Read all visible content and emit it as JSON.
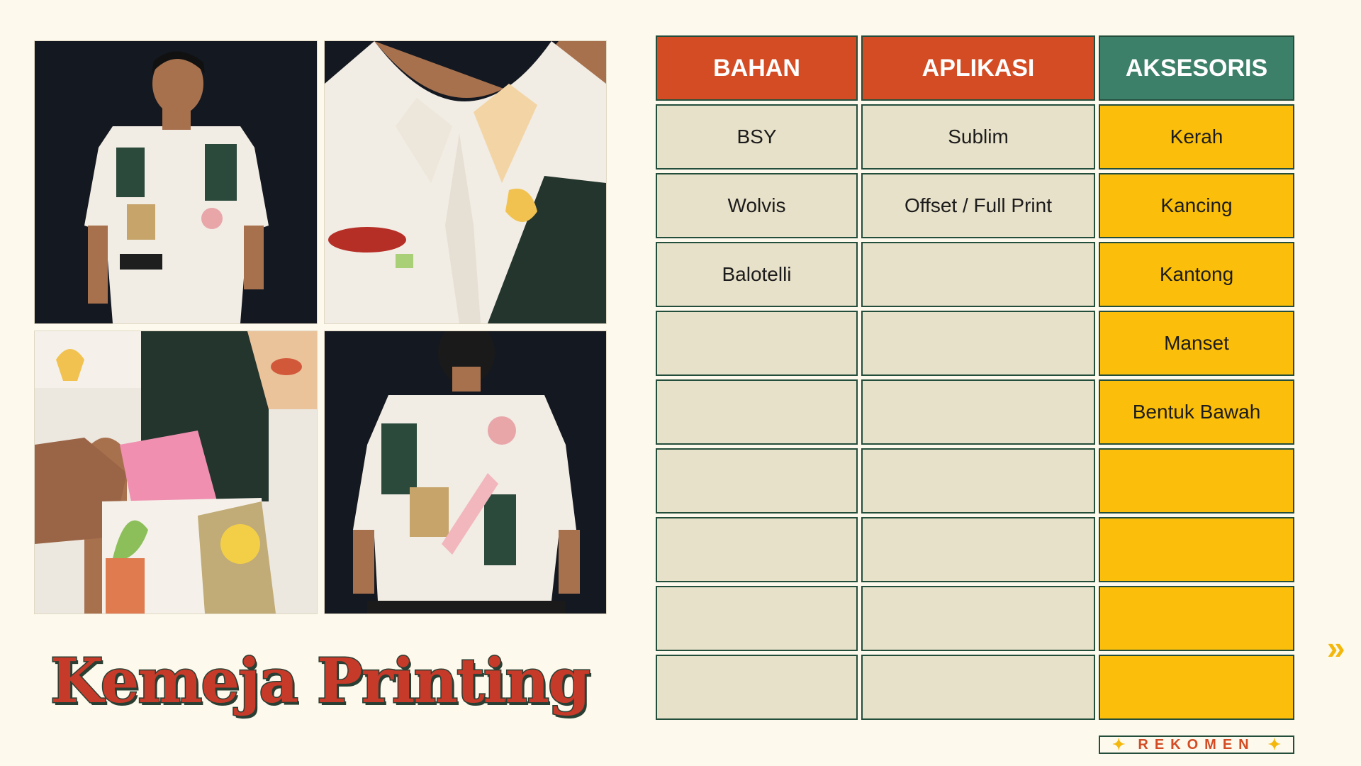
{
  "title": "Kemeja Printing",
  "photos": [
    {
      "icon": "model-front-photo"
    },
    {
      "icon": "collar-closeup-photo"
    },
    {
      "icon": "pocket-closeup-photo"
    },
    {
      "icon": "model-back-photo"
    }
  ],
  "table": {
    "headers": [
      "BAHAN",
      "APLIKASI",
      "AKSESORIS"
    ],
    "header_colors": [
      "#d34c24",
      "#d34c24",
      "#3c8069"
    ],
    "rows": [
      [
        "BSY",
        "Sublim",
        "Kerah"
      ],
      [
        "Wolvis",
        "Offset / Full Print",
        "Kancing"
      ],
      [
        "Balotelli",
        "",
        "Kantong"
      ],
      [
        "",
        "",
        "Manset"
      ],
      [
        "",
        "",
        "Bentuk Bawah"
      ],
      [
        "",
        "",
        ""
      ],
      [
        "",
        "",
        ""
      ],
      [
        "",
        "",
        ""
      ],
      [
        "",
        "",
        ""
      ]
    ]
  },
  "next_icon": "double-chevron-right-icon",
  "badge": {
    "label": "REKOMEN",
    "icon": "sparkle-icon"
  },
  "colors": {
    "background": "#fdf9ec",
    "title": "#c63a2a",
    "header_red": "#d34c24",
    "header_teal": "#3c8069",
    "cell_beige": "#e8e1c9",
    "cell_yellow": "#fbbf0b",
    "border": "#244e3c"
  }
}
